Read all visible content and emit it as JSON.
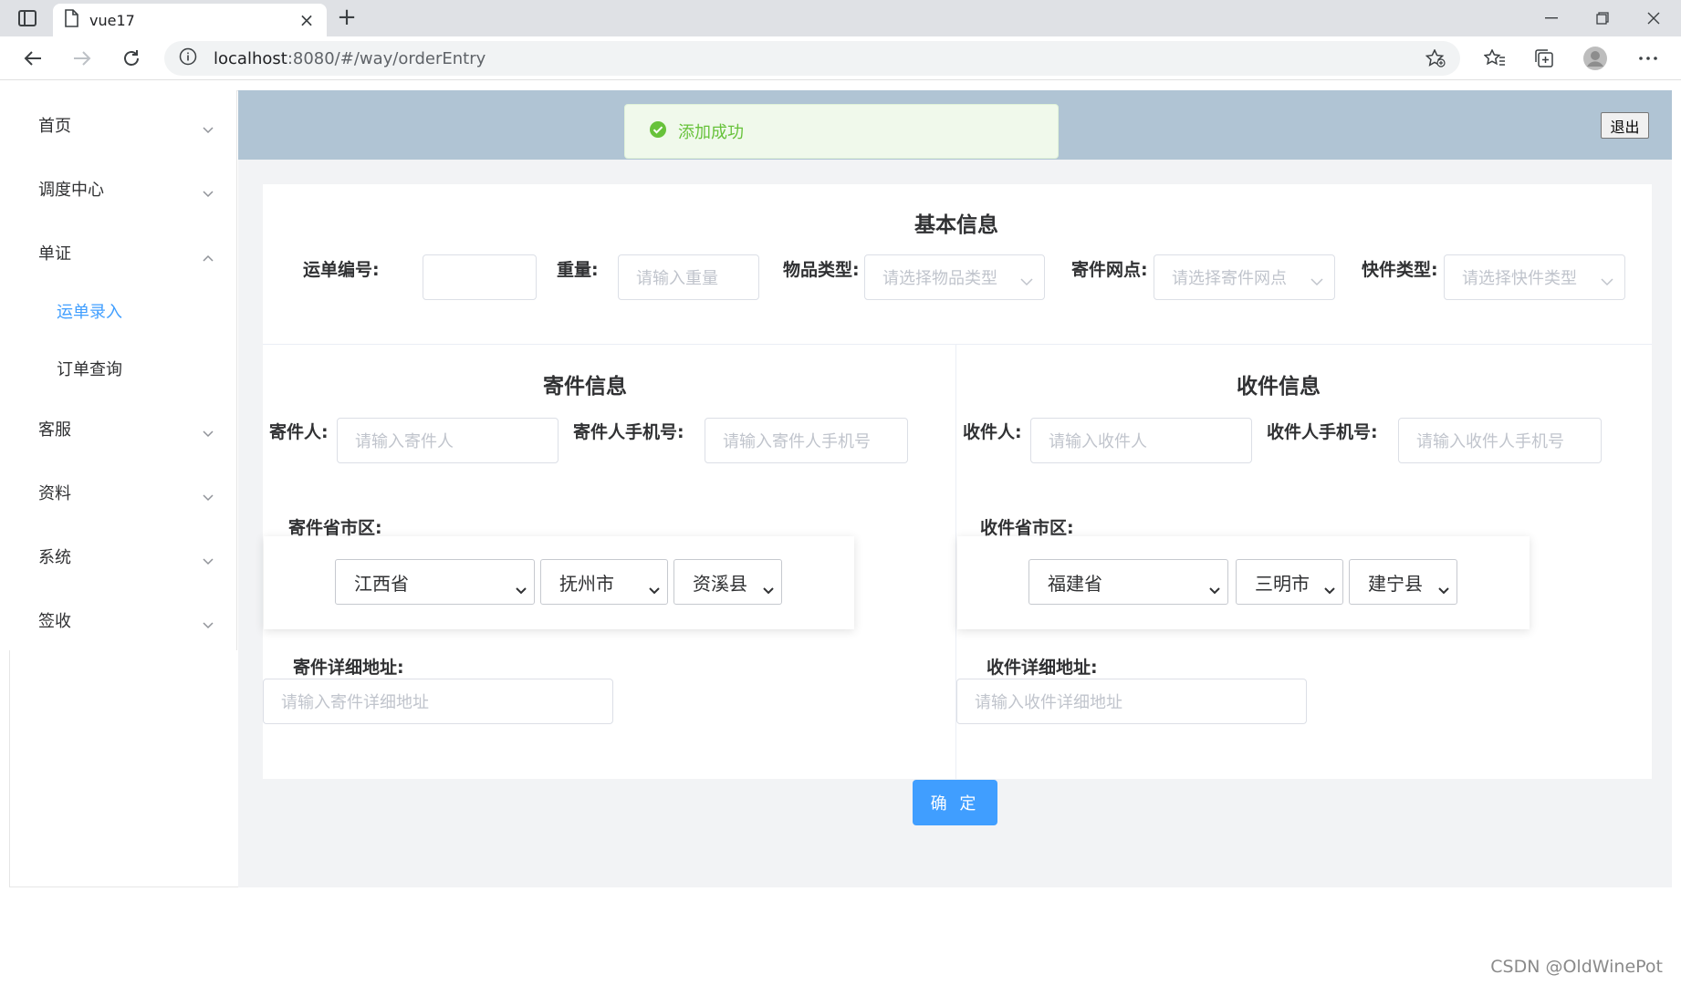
{
  "browser": {
    "tab_title": "vue17",
    "url_host": "localhost",
    "url_path": ":8080/#/way/orderEntry"
  },
  "sidebar": {
    "items": [
      {
        "label": "首页",
        "expanded": false
      },
      {
        "label": "调度中心",
        "expanded": false
      },
      {
        "label": "单证",
        "expanded": true
      },
      {
        "label": "客服",
        "expanded": false
      },
      {
        "label": "资料",
        "expanded": false
      },
      {
        "label": "系统",
        "expanded": false
      },
      {
        "label": "签收",
        "expanded": false
      }
    ],
    "subitems": [
      {
        "label": "运单录入",
        "active": true
      },
      {
        "label": "订单查询",
        "active": false
      }
    ]
  },
  "header": {
    "logout_label": "退出"
  },
  "toast": {
    "message": "添加成功",
    "type": "success"
  },
  "basic_info": {
    "title": "基本信息",
    "waybill_no_label": "运单编号:",
    "waybill_no_value": "",
    "weight_label": "重量:",
    "weight_placeholder": "请输入重量",
    "goods_type_label": "物品类型:",
    "goods_type_placeholder": "请选择物品类型",
    "send_branch_label": "寄件网点:",
    "send_branch_placeholder": "请选择寄件网点",
    "express_type_label": "快件类型:",
    "express_type_placeholder": "请选择快件类型"
  },
  "sender": {
    "title": "寄件信息",
    "name_label": "寄件人:",
    "name_placeholder": "请输入寄件人",
    "phone_label": "寄件人手机号:",
    "phone_placeholder": "请输入寄件人手机号",
    "region_label": "寄件省市区:",
    "province": "江西省",
    "city": "抚州市",
    "county": "资溪县",
    "address_label": "寄件详细地址:",
    "address_placeholder": "请输入寄件详细地址"
  },
  "receiver": {
    "title": "收件信息",
    "name_label": "收件人:",
    "name_placeholder": "请输入收件人",
    "phone_label": "收件人手机号:",
    "phone_placeholder": "请输入收件人手机号",
    "region_label": "收件省市区:",
    "province": "福建省",
    "city": "三明市",
    "county": "建宁县",
    "address_label": "收件详细地址:",
    "address_placeholder": "请输入收件详细地址"
  },
  "actions": {
    "confirm_label": "确 定"
  },
  "watermark": "CSDN @OldWinePot",
  "colors": {
    "primary": "#409eff",
    "header_bg": "#b0c4d4",
    "success": "#67c23a",
    "success_bg": "#f0f9eb"
  }
}
